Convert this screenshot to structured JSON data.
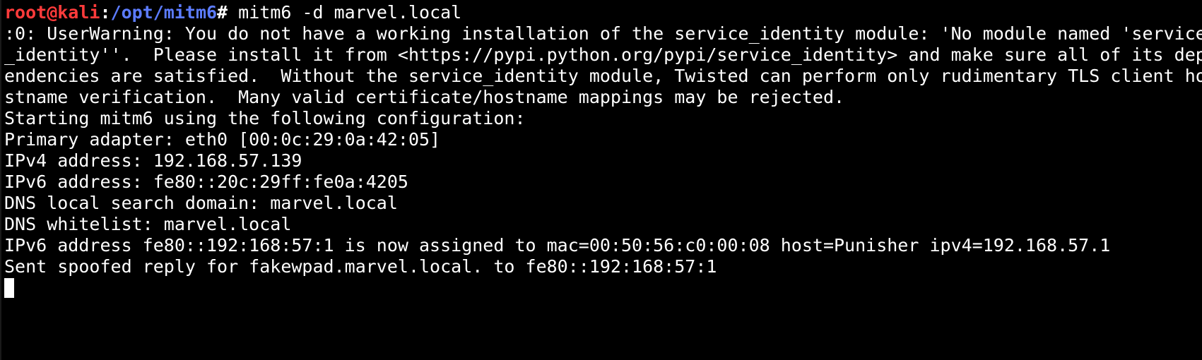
{
  "prompt": {
    "user_host": "root@kali",
    "colon": ":",
    "path": "/opt/mitm6",
    "hash": "#",
    "command": " mitm6 -d marvel.local"
  },
  "output": [
    ":0: UserWarning: You do not have a working installation of the service_identity module: 'No module named 'service",
    "_identity''.  Please install it from <https://pypi.python.org/pypi/service_identity> and make sure all of its dep",
    "endencies are satisfied.  Without the service_identity module, Twisted can perform only rudimentary TLS client ho",
    "stname verification.  Many valid certificate/hostname mappings may be rejected.",
    "Starting mitm6 using the following configuration:",
    "Primary adapter: eth0 [00:0c:29:0a:42:05]",
    "IPv4 address: 192.168.57.139",
    "IPv6 address: fe80::20c:29ff:fe0a:4205",
    "DNS local search domain: marvel.local",
    "DNS whitelist: marvel.local",
    "IPv6 address fe80::192:168:57:1 is now assigned to mac=00:50:56:c0:00:08 host=Punisher ipv4=192.168.57.1",
    "Sent spoofed reply for fakewpad.marvel.local. to fe80::192:168:57:1"
  ],
  "colors": {
    "background": "#000000",
    "text": "#ffffff",
    "prompt_user": "#ff3b3b",
    "prompt_path": "#5c7cff"
  }
}
